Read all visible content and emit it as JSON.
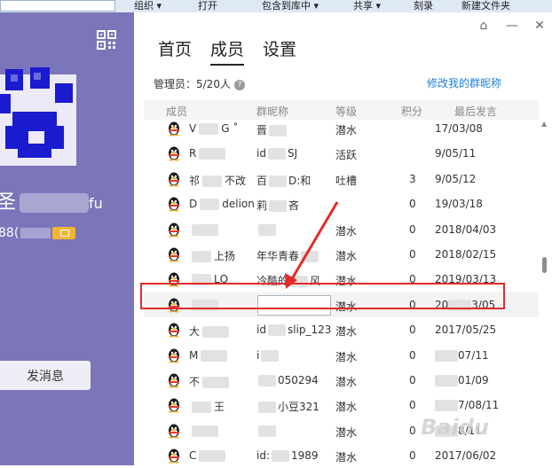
{
  "explorer_toolbar": {
    "menus": [
      "组织 ▾",
      "打开",
      "包含到库中 ▾",
      "共享 ▾",
      "刻录",
      "新建文件夹"
    ]
  },
  "profile": {
    "nickname_visible": "圣",
    "nickname_suffix": "fu",
    "qq_prefix": "88(",
    "send_message": "发消息"
  },
  "tabs": [
    "首页",
    "成员",
    "设置"
  ],
  "active_tab": "成员",
  "admins_label": "管理员：5/20人",
  "help_icon_glyph": "?",
  "modify_link": "修改我的群昵称",
  "table_headers": {
    "member": "成员",
    "card": "群昵称",
    "level": "等级",
    "points": "积分",
    "last_speak": "最后发言"
  },
  "members": [
    {
      "name": "V",
      "name2": "G ˚",
      "card": "晋",
      "level": "潜水",
      "points": "",
      "last": "17/03/08"
    },
    {
      "name": "R",
      "name2": "",
      "card": "id",
      "card2": "SJ",
      "level": "活跃",
      "points": "",
      "last": "9/05/11"
    },
    {
      "name": "祁",
      "name2": "不改",
      "card": "百",
      "card2": "D:和",
      "level": "吐槽",
      "points": "3",
      "last": "9/05/12"
    },
    {
      "name": "D",
      "name2": "delion",
      "card": "莉",
      "card2": "吝",
      "level": "",
      "points": "0",
      "last": "19/03/18"
    },
    {
      "name": "",
      "name2": "",
      "card": "",
      "level": "潜水",
      "points": "0",
      "last": "2018/04/03"
    },
    {
      "name": "",
      "name2": "上扬",
      "card": "年华青春",
      "level": "潜水",
      "points": "0",
      "last": "2018/02/15"
    },
    {
      "name": "",
      "name2": "LQ",
      "card": "冷酷的",
      "card2": "风",
      "level": "潜水",
      "points": "0",
      "last": "2019/03/13"
    },
    {
      "name": "",
      "name2": "",
      "card": "",
      "level": "潜水",
      "points": "0",
      "last": "20",
      "last2": "3/05",
      "editing": true
    },
    {
      "name": "大",
      "name2": "",
      "card": "id",
      "card2": "slip_123",
      "level": "潜水",
      "points": "0",
      "last": "2017/05/25"
    },
    {
      "name": "M",
      "name2": "",
      "card": "i",
      "card2": "",
      "level": "潜水",
      "points": "0",
      "last": "",
      "last2": "07/11"
    },
    {
      "name": "不",
      "name2": "",
      "card": "",
      "card2": "050294",
      "level": "潜水",
      "points": "0",
      "last": "",
      "last2": "01/09"
    },
    {
      "name": "",
      "name2": "王",
      "card": "",
      "card2": "小豆321",
      "level": "潜水",
      "points": "0",
      "last": "",
      "last2": "7/08/11"
    },
    {
      "name": "",
      "name2": "",
      "card": "",
      "level": "潜水",
      "points": "0",
      "last": "",
      "last2": "8/11"
    },
    {
      "name": "C",
      "name2": "",
      "card": "id:",
      "card2": "1989",
      "level": "潜水",
      "points": "0",
      "last": "2017/06/02"
    }
  ],
  "watermark": "Baidu",
  "colors": {
    "left_panel": "#7b76b9",
    "link": "#1e7fd2",
    "highlight": "#e32b2b"
  },
  "icons": {
    "qr": "qr-code-icon",
    "pin": "pin-icon",
    "minimize": "minimize-icon",
    "close": "close-icon",
    "help": "help-icon",
    "member": "qq-penguin-icon"
  }
}
